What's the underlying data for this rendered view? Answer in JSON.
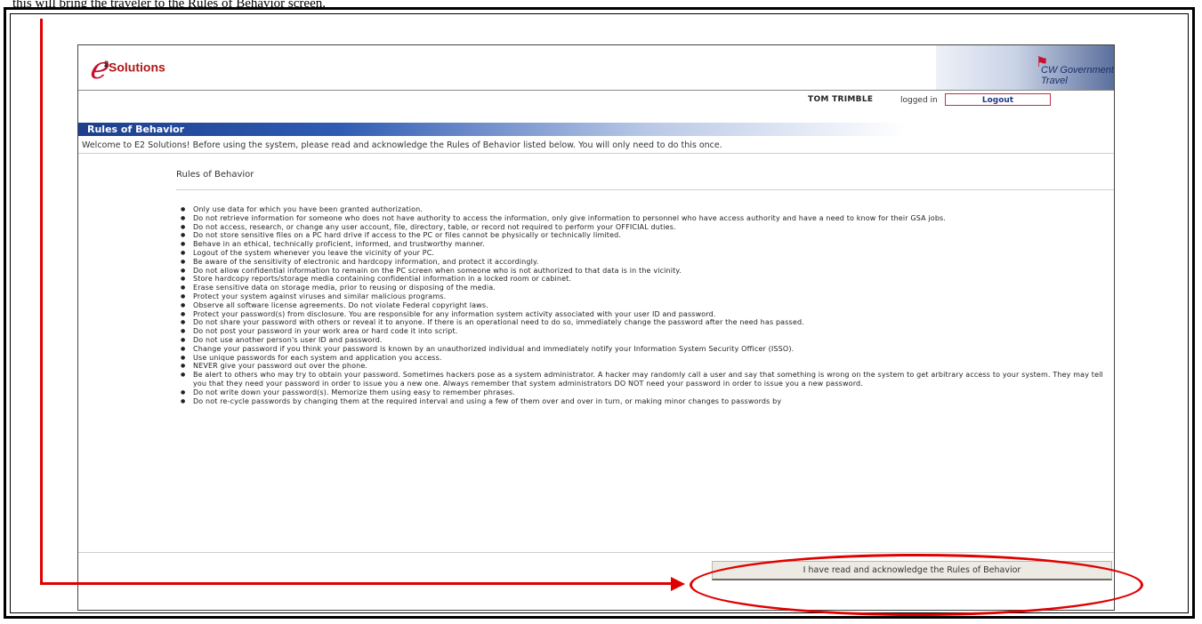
{
  "document": {
    "caption": "this will bring the traveler to the Rules of Behavior screen."
  },
  "header": {
    "logo_text": "Solutions",
    "logo_sup": "2",
    "partner_text": "CW Government Travel"
  },
  "login": {
    "user": "TOM TRIMBLE",
    "status": "logged in",
    "logout_label": "Logout"
  },
  "page": {
    "section_title": "Rules of Behavior",
    "welcome": "Welcome to E2 Solutions! Before using the system, please read and acknowledge the Rules of Behavior listed below. You will only need to do this once.",
    "rules_heading": "Rules of Behavior"
  },
  "rules": [
    "Only use data for which you have been granted authorization.",
    "Do not retrieve information for someone who does not have authority to access the information, only give information to personnel who have access authority and have a need to know for their GSA jobs.",
    "Do not access, research, or change any user account, file, directory, table, or record not required to perform your OFFICIAL duties.",
    "Do not store sensitive files on a PC hard drive if access to the PC or files cannot be physically or technically limited.",
    "Behave in an ethical, technically proficient, informed, and trustworthy manner.",
    "Logout of the system whenever you leave the vicinity of your PC.",
    "Be aware of the sensitivity of electronic and hardcopy information, and protect it accordingly.",
    "Do not allow confidential information to remain on the PC screen when someone who is not authorized to that data is in the vicinity.",
    "Store hardcopy reports/storage media containing confidential information in a locked room or cabinet.",
    "Erase sensitive data on storage media, prior to reusing or disposing of the media.",
    "Protect your system against viruses and similar malicious programs.",
    "Observe all software license agreements. Do not violate Federal copyright laws.",
    "Protect your password(s) from disclosure. You are responsible for any information system activity associated with your user ID and password.",
    "Do not share your password with others or reveal it to anyone. If there is an operational need to do so, immediately change the password after the need has passed.",
    "Do not post your password in your work area or hard code it into script.",
    "Do not use another person's user ID and password.",
    "Change your password if you think your password is known by an unauthorized individual and immediately notify your Information System Security Officer (ISSO).",
    "Use unique passwords for each system and application you access.",
    "NEVER give your password out over the phone.",
    "Be alert to others who may try to obtain your password. Sometimes hackers pose as a system administrator. A hacker may randomly call a user and say that something is wrong on the system to get arbitrary access to your system. They may tell you that they need your password in order to issue you a new one. Always remember that system administrators DO NOT need your password in order to issue you a new password.",
    "Do not write down your password(s). Memorize them using easy to remember phrases.",
    "Do not re-cycle passwords by changing them at the required interval and using a few of them over and over in turn, or making minor changes to passwords by"
  ],
  "actions": {
    "acknowledge_label": "I have read and acknowledge the Rules of Behavior"
  },
  "colors": {
    "annotation_red": "#e00000",
    "section_bar_blue": "#1d3f8c",
    "brand_red": "#c8102e"
  }
}
